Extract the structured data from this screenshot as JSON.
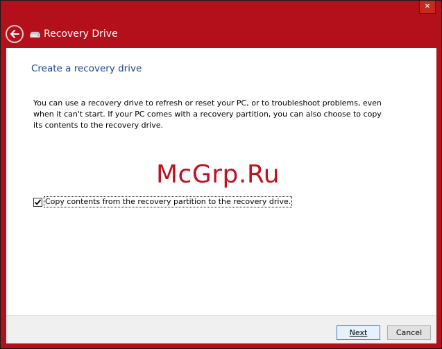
{
  "window": {
    "title": "Recovery Drive",
    "close_glyph": "✕",
    "back_icon": "back-arrow-icon",
    "drive_icon": "drive-icon"
  },
  "page": {
    "heading": "Create a recovery drive",
    "description": "You can use a recovery drive to refresh or reset your PC, or to troubleshoot problems, even when it can't start. If your PC comes with a recovery partition, you can also choose to copy its contents to the recovery drive.",
    "watermark": "McGrp.Ru",
    "checkbox": {
      "label": "Copy contents from the recovery partition to the recovery drive.",
      "checked": true
    }
  },
  "footer": {
    "next_label": "Next",
    "cancel_label": "Cancel"
  },
  "colors": {
    "titlebar": "#b3101b",
    "heading": "#1e3f8a",
    "watermark": "#c0121e"
  }
}
